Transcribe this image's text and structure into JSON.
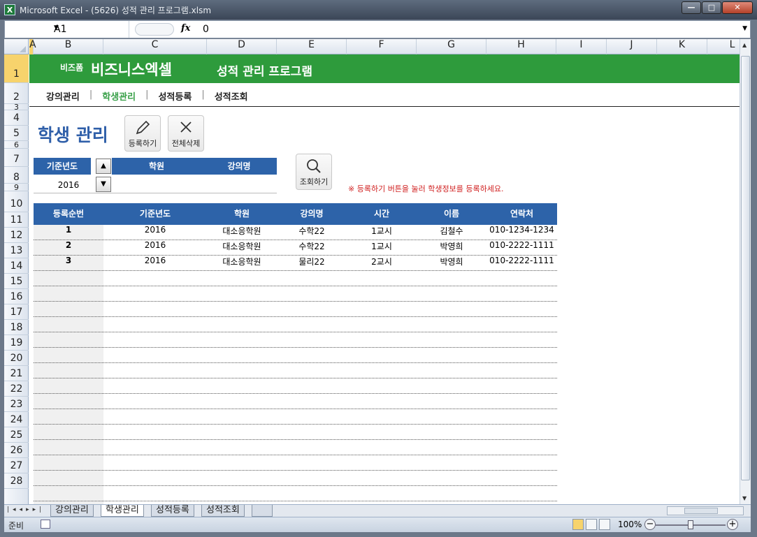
{
  "window": {
    "title": "Microsoft Excel - (5626) 성적 관리 프로그램.xlsm",
    "app_icon": "X",
    "buttons": {
      "minimize": "—",
      "maximize": "□",
      "close": "✕"
    }
  },
  "formula_bar": {
    "name_box": "A1",
    "fx": "fx",
    "value": "0"
  },
  "columns": [
    "A",
    "B",
    "C",
    "D",
    "E",
    "F",
    "G",
    "H",
    "I",
    "J",
    "K",
    "L"
  ],
  "rows": [
    "1",
    "2",
    "3",
    "4",
    "5",
    "6",
    "7",
    "8",
    "9",
    "10",
    "11",
    "12",
    "13",
    "14",
    "15",
    "16",
    "17",
    "18",
    "19",
    "20",
    "21",
    "22",
    "23",
    "24",
    "25",
    "26",
    "27",
    "28"
  ],
  "banner": {
    "brand_small": "비즈폼",
    "brand_big": "비즈니스엑셀",
    "program_title": "성적 관리 프로그램",
    "color": "#2e9b3c"
  },
  "nav": {
    "items": [
      "강의관리",
      "학생관리",
      "성적등록",
      "성적조회"
    ],
    "separator": "|",
    "active": "학생관리"
  },
  "page": {
    "title": "학생 관리",
    "register_button": "등록하기",
    "delete_all_button": "전체삭제",
    "search_button": "조회하기",
    "hint": "※ 등록하기 버튼을 눌러 학생정보를 등록하세요."
  },
  "filter": {
    "headers": [
      "기준년도",
      "학원",
      "강의명"
    ],
    "year_value": "2016",
    "academy_value": "",
    "course_value": ""
  },
  "table": {
    "headers": [
      "등록순번",
      "기준년도",
      "학원",
      "강의명",
      "시간",
      "이름",
      "연락처"
    ],
    "rows": [
      [
        "1",
        "2016",
        "대소응학원",
        "수학22",
        "1교시",
        "김철수",
        "010-1234-1234"
      ],
      [
        "2",
        "2016",
        "대소응학원",
        "수학22",
        "1교시",
        "박영희",
        "010-2222-1111"
      ],
      [
        "3",
        "2016",
        "대소응학원",
        "물리22",
        "2교시",
        "박영희",
        "010-2222-1111"
      ]
    ]
  },
  "sheet_tabs": [
    "강의관리",
    "학생관리",
    "성적등록",
    "성적조회"
  ],
  "active_sheet": "학생관리",
  "status": {
    "mode": "준비",
    "zoom": "100%"
  },
  "colors": {
    "header_blue": "#2d63a9",
    "title_blue": "#2f5fa9",
    "hint_red": "#d02020",
    "nav_active_green": "#3aa14a"
  }
}
